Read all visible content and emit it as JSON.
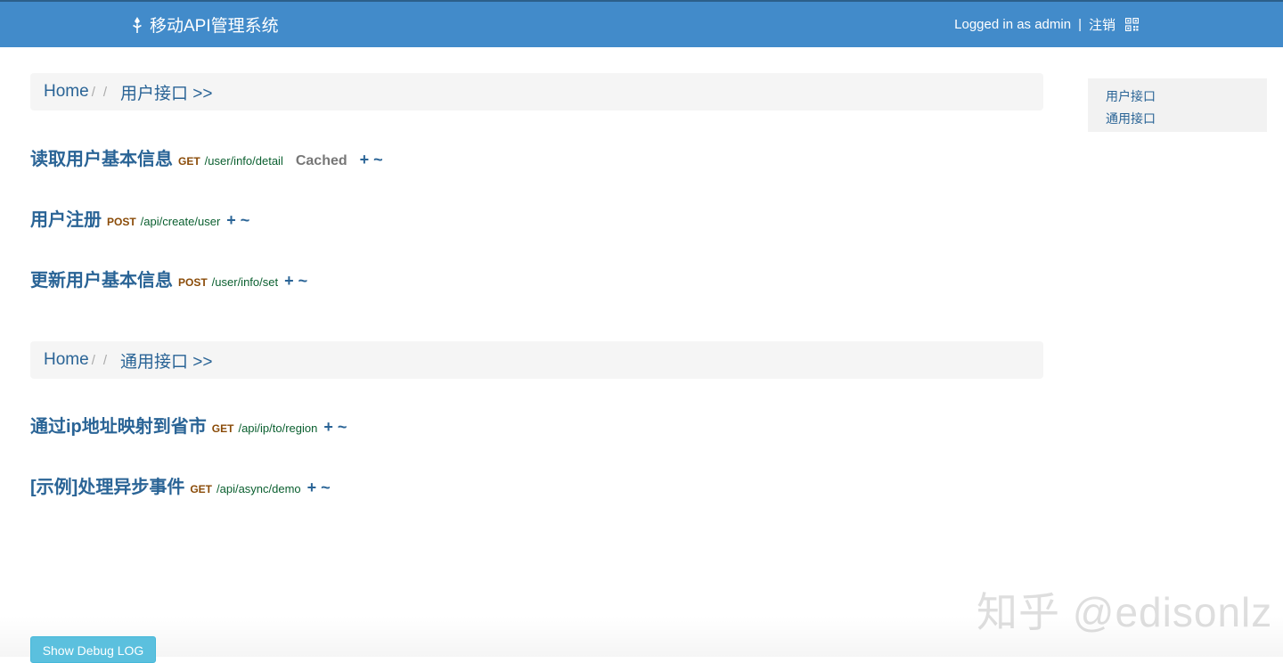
{
  "header": {
    "title": "移动API管理系统",
    "logged_in_text": "Logged in as admin",
    "separator": "|",
    "logout_label": "注销",
    "brand_icon": "leaf-icon",
    "qr_icon": "qrcode-icon"
  },
  "sections": [
    {
      "breadcrumb": {
        "home": "Home",
        "sep": "/",
        "current": "用户接口 >>"
      },
      "apis": [
        {
          "title": "读取用户基本信息",
          "method": "GET",
          "path": "/user/info/detail",
          "cached": "Cached",
          "actions": "+ ~"
        },
        {
          "title": "用户注册",
          "method": "POST",
          "path": "/api/create/user",
          "actions": "+ ~"
        },
        {
          "title": "更新用户基本信息",
          "method": "POST",
          "path": "/user/info/set",
          "actions": "+ ~"
        }
      ]
    },
    {
      "breadcrumb": {
        "home": "Home",
        "sep": "/",
        "current": "通用接口 >>"
      },
      "apis": [
        {
          "title": "通过ip地址映射到省市",
          "method": "GET",
          "path": "/api/ip/to/region",
          "actions": "+ ~"
        },
        {
          "title": "[示例]处理异步事件",
          "method": "GET",
          "path": "/api/async/demo",
          "actions": "+ ~"
        }
      ]
    }
  ],
  "sidebar": {
    "items": [
      {
        "label": "用户接口"
      },
      {
        "label": "通用接口"
      }
    ]
  },
  "footer": {
    "debug_button": "Show Debug LOG",
    "watermark": "知乎 @edisonlz"
  },
  "colors": {
    "navbar": "#428bca",
    "link": "#2a6496",
    "method": "#8a4b08",
    "path": "#0a5f2f",
    "debug_button": "#5bc0de"
  }
}
